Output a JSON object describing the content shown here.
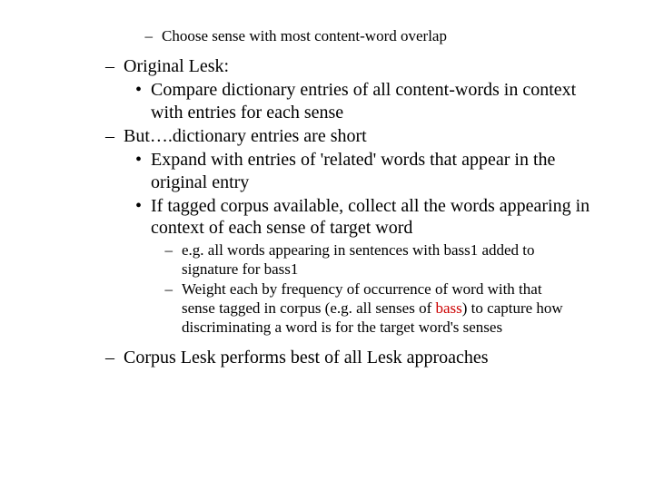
{
  "bullets": {
    "dash": "–",
    "dot": "•"
  },
  "top": "Choose sense with most content-word overlap",
  "p1": "Original Lesk:",
  "p1a": "Compare dictionary entries of all content-words in context with entries for each sense",
  "p2": "But….dictionary entries are short",
  "p2a": "Expand with entries of 'related' words that appear in the original entry",
  "p2b": "If tagged corpus available, collect all the words appearing in context of each sense of target word",
  "p2b_i": "e.g. all words appearing in sentences with bass1 added to signature for bass1",
  "p2b_ii_pre": "Weight each by frequency of occurrence of word with that sense tagged in corpus (e.g. all senses of ",
  "p2b_ii_red": "bass",
  "p2b_ii_post": ") to capture how discriminating a word is for the target word's senses",
  "p3": "Corpus Lesk performs best of all Lesk approaches"
}
